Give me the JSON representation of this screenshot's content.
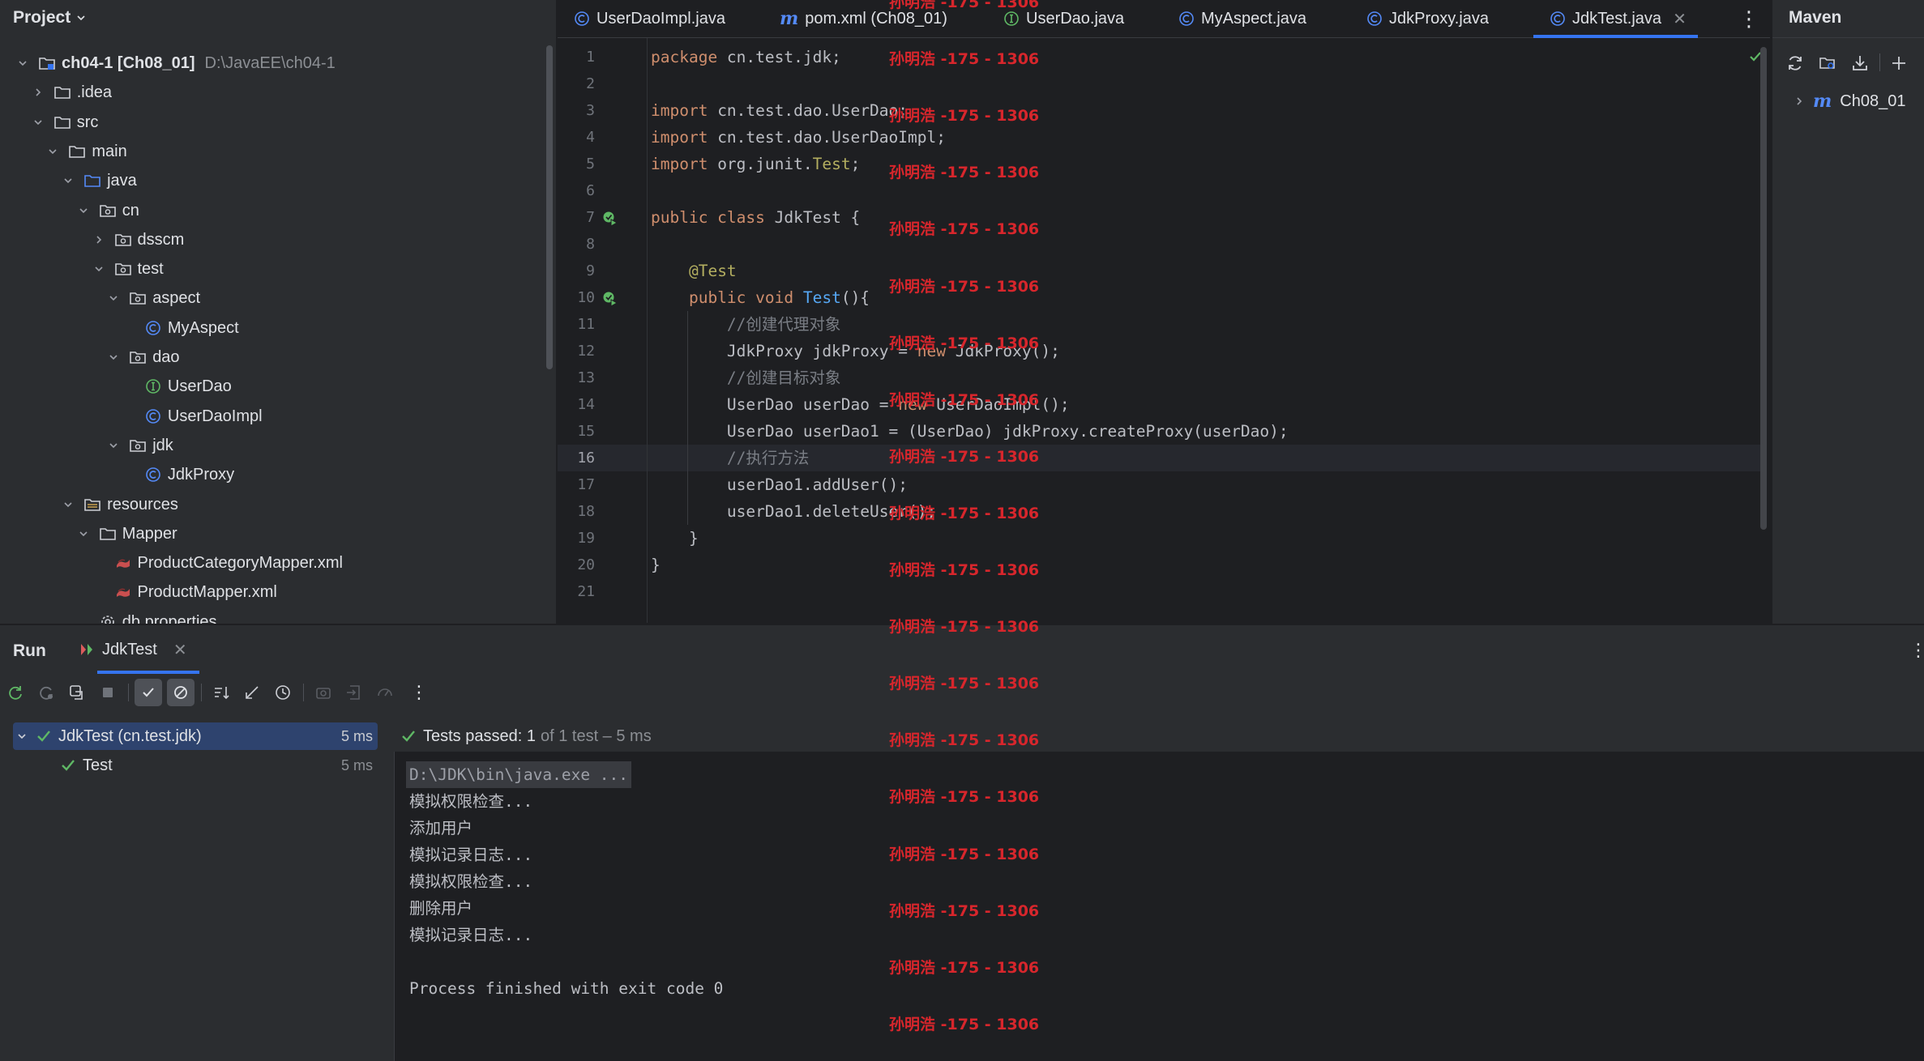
{
  "project": {
    "title": "Project",
    "tree": [
      {
        "label": "ch04-1 [Ch08_01]",
        "path": "D:\\JavaEE\\ch04-1",
        "icon": "module-folder-icon",
        "depth": 0,
        "expanded": true
      },
      {
        "label": ".idea",
        "icon": "folder-icon",
        "depth": 1,
        "expanded": false
      },
      {
        "label": "src",
        "icon": "folder-icon",
        "depth": 1,
        "expanded": true
      },
      {
        "label": "main",
        "icon": "folder-icon",
        "depth": 2,
        "expanded": true
      },
      {
        "label": "java",
        "icon": "source-folder-icon",
        "depth": 3,
        "expanded": true
      },
      {
        "label": "cn",
        "icon": "package-icon",
        "depth": 4,
        "expanded": true
      },
      {
        "label": "dsscm",
        "icon": "package-icon",
        "depth": 5,
        "expanded": false
      },
      {
        "label": "test",
        "icon": "package-icon",
        "depth": 5,
        "expanded": true
      },
      {
        "label": "aspect",
        "icon": "package-icon",
        "depth": 6,
        "expanded": true
      },
      {
        "label": "MyAspect",
        "icon": "class-icon",
        "depth": 7
      },
      {
        "label": "dao",
        "icon": "package-icon",
        "depth": 6,
        "expanded": true
      },
      {
        "label": "UserDao",
        "icon": "interface-icon",
        "depth": 7
      },
      {
        "label": "UserDaoImpl",
        "icon": "class-icon",
        "depth": 7
      },
      {
        "label": "jdk",
        "icon": "package-icon",
        "depth": 6,
        "expanded": true
      },
      {
        "label": "JdkProxy",
        "icon": "class-icon",
        "depth": 7
      },
      {
        "label": "resources",
        "icon": "resources-folder-icon",
        "depth": 3,
        "expanded": true
      },
      {
        "label": "Mapper",
        "icon": "folder-icon",
        "depth": 4,
        "expanded": true
      },
      {
        "label": "ProductCategoryMapper.xml",
        "icon": "mybatis-xml-icon",
        "depth": 5
      },
      {
        "label": "ProductMapper.xml",
        "icon": "mybatis-xml-icon",
        "depth": 5
      },
      {
        "label": "db.properties",
        "icon": "properties-icon",
        "depth": 4
      }
    ]
  },
  "editor": {
    "tabs": [
      {
        "label": "UserDaoImpl.java",
        "icon": "class-icon",
        "active": false
      },
      {
        "label": "pom.xml (Ch08_01)",
        "icon": "maven-icon",
        "active": false
      },
      {
        "label": "UserDao.java",
        "icon": "interface-icon",
        "active": false
      },
      {
        "label": "MyAspect.java",
        "icon": "class-icon",
        "active": false
      },
      {
        "label": "JdkProxy.java",
        "icon": "class-icon",
        "active": false
      },
      {
        "label": "JdkTest.java",
        "icon": "class-icon",
        "active": true
      }
    ],
    "current_line": 16,
    "lines": [
      {
        "n": "1",
        "tokens": [
          {
            "t": "package ",
            "c": "kw"
          },
          {
            "t": "cn.test.jdk;",
            "c": ""
          }
        ]
      },
      {
        "n": "2",
        "tokens": []
      },
      {
        "n": "3",
        "tokens": [
          {
            "t": "import ",
            "c": "kw"
          },
          {
            "t": "cn.test.dao.UserDao;",
            "c": ""
          }
        ]
      },
      {
        "n": "4",
        "tokens": [
          {
            "t": "import ",
            "c": "kw"
          },
          {
            "t": "cn.test.dao.UserDaoImpl;",
            "c": ""
          }
        ]
      },
      {
        "n": "5",
        "tokens": [
          {
            "t": "import ",
            "c": "kw"
          },
          {
            "t": "org.junit.",
            "c": ""
          },
          {
            "t": "Test",
            "c": "ann"
          },
          {
            "t": ";",
            "c": ""
          }
        ]
      },
      {
        "n": "6",
        "tokens": []
      },
      {
        "n": "7",
        "tokens": [
          {
            "t": "public class ",
            "c": "kw"
          },
          {
            "t": "JdkTest {",
            "c": ""
          }
        ],
        "gutter_run": true
      },
      {
        "n": "8",
        "tokens": []
      },
      {
        "n": "9",
        "tokens": [
          {
            "t": "    ",
            "c": ""
          },
          {
            "t": "@Test",
            "c": "ann"
          }
        ]
      },
      {
        "n": "10",
        "tokens": [
          {
            "t": "    ",
            "c": ""
          },
          {
            "t": "public void ",
            "c": "kw"
          },
          {
            "t": "Test",
            "c": "fn"
          },
          {
            "t": "(){",
            "c": ""
          }
        ],
        "gutter_run": true
      },
      {
        "n": "11",
        "tokens": [
          {
            "t": "        ",
            "c": ""
          },
          {
            "t": "//创建代理对象",
            "c": "cm"
          }
        ]
      },
      {
        "n": "12",
        "tokens": [
          {
            "t": "        JdkProxy jdkProxy = ",
            "c": ""
          },
          {
            "t": "new ",
            "c": "kw"
          },
          {
            "t": "JdkProxy();",
            "c": ""
          }
        ]
      },
      {
        "n": "13",
        "tokens": [
          {
            "t": "        ",
            "c": ""
          },
          {
            "t": "//创建目标对象",
            "c": "cm"
          }
        ]
      },
      {
        "n": "14",
        "tokens": [
          {
            "t": "        UserDao userDao = ",
            "c": ""
          },
          {
            "t": "new ",
            "c": "kw"
          },
          {
            "t": "UserDaoImpl();",
            "c": ""
          }
        ]
      },
      {
        "n": "15",
        "tokens": [
          {
            "t": "        UserDao userDao1 = (UserDao) jdkProxy.createProxy(userDao);",
            "c": ""
          }
        ]
      },
      {
        "n": "16",
        "tokens": [
          {
            "t": "        ",
            "c": ""
          },
          {
            "t": "//执行方法",
            "c": "cm"
          }
        ]
      },
      {
        "n": "17",
        "tokens": [
          {
            "t": "        userDao1.addUser();",
            "c": ""
          }
        ]
      },
      {
        "n": "18",
        "tokens": [
          {
            "t": "        userDao1.deleteUser();",
            "c": ""
          }
        ]
      },
      {
        "n": "19",
        "tokens": [
          {
            "t": "    }",
            "c": ""
          }
        ]
      },
      {
        "n": "20",
        "tokens": [
          {
            "t": "}",
            "c": ""
          }
        ]
      },
      {
        "n": "21",
        "tokens": []
      }
    ]
  },
  "maven": {
    "title": "Maven",
    "root": "Ch08_01"
  },
  "run": {
    "title": "Run",
    "tab_label": "JdkTest",
    "tests": [
      {
        "label": "JdkTest (cn.test.jdk)",
        "time": "5 ms",
        "selected": true
      },
      {
        "label": "Test",
        "time": "5 ms",
        "selected": false
      }
    ],
    "status": {
      "prefix": "Tests passed: ",
      "passed": "1",
      "suffix": "of 1 test – 5 ms"
    },
    "console": [
      "D:\\JDK\\bin\\java.exe ...",
      "模拟权限检查...",
      "添加用户",
      "模拟记录日志...",
      "模拟权限检查...",
      "删除用户",
      "模拟记录日志...",
      "",
      "Process finished with exit code 0"
    ]
  },
  "watermark": "孙明浩 -175 - 1306",
  "colors": {
    "accent": "#3574f0",
    "success": "#5fb865",
    "keyword": "#cf8e6d",
    "annotation": "#b3ae60",
    "method": "#56a8f5",
    "comment": "#7a7e85",
    "watermark": "#d7262c"
  }
}
